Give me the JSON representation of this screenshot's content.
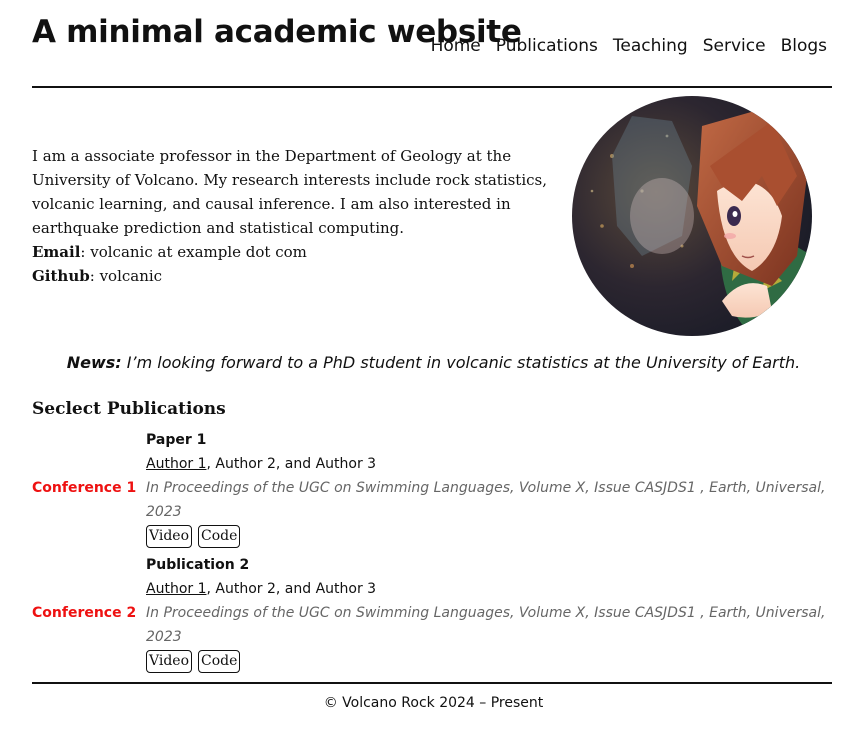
{
  "site": {
    "title": "A minimal academic website",
    "nav": [
      "Home",
      "Publications",
      "Teaching",
      "Service",
      "Blogs"
    ]
  },
  "about": {
    "bio": "I am a associate professor in the Department of Geology at the University of Volcano. My research interests include rock statistics, volcanic learning, and causal inference. I am also interested in earthquake prediction and statistical computing.",
    "email_label": "Email",
    "email_value": ": volcanic at example dot com",
    "github_label": "Github",
    "github_value": ": volcanic"
  },
  "news": {
    "label": "News:",
    "text": "I’m looking forward to a PhD student in volcanic statistics at the University of Earth."
  },
  "publications": {
    "heading": "Seclect Publications",
    "items": [
      {
        "venue": "Conference 1",
        "title": "Paper 1",
        "first_author": "Author 1",
        "other_authors": ", Author 2, and Author 3",
        "citation": "In Proceedings of the UGC on Swimming Languages, Volume X, Issue CASJDS1 , Earth, Universal, 2023",
        "links": [
          "Video",
          "Code"
        ]
      },
      {
        "venue": "Conference 2",
        "title": "Publication 2",
        "first_author": "Author 1",
        "other_authors": ", Author 2, and Author 3",
        "citation": "In Proceedings of the UGC on Swimming Languages, Volume X, Issue CASJDS1 , Earth, Universal, 2023",
        "links": [
          "Video",
          "Code"
        ]
      }
    ]
  },
  "footer": {
    "text": "© Volcano Rock 2024 – Present"
  },
  "colors": {
    "venue": "#ee1111",
    "citation": "#666666",
    "text": "#111111"
  }
}
